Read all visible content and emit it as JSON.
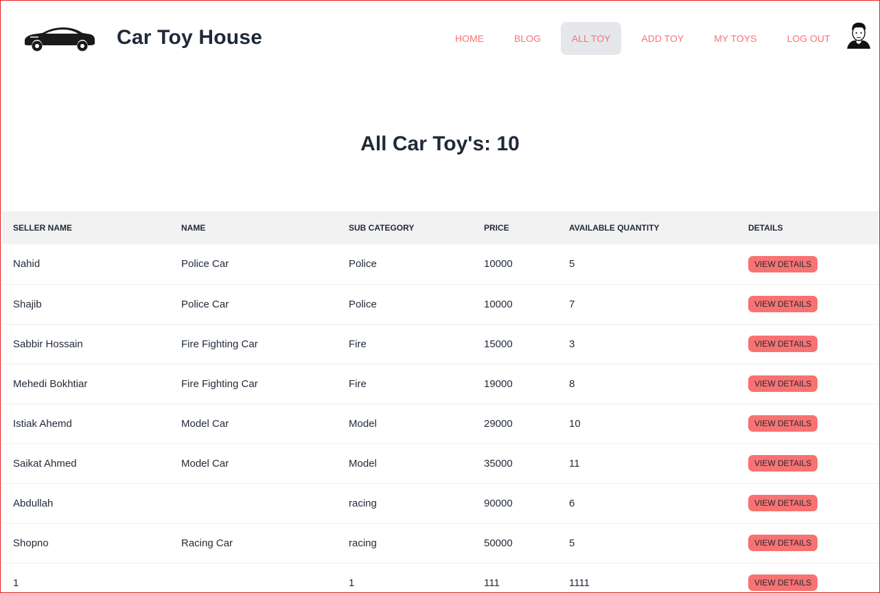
{
  "navbar": {
    "brand": "Car Toy House",
    "links": [
      {
        "label": "Home",
        "active": false
      },
      {
        "label": "Blog",
        "active": false
      },
      {
        "label": "All Toy",
        "active": true
      },
      {
        "label": "Add Toy",
        "active": false
      },
      {
        "label": "My Toys",
        "active": false
      },
      {
        "label": "Log Out",
        "active": false
      }
    ]
  },
  "page": {
    "title": "All Car Toy's: 10"
  },
  "table": {
    "headers": [
      "Seller Name",
      "Name",
      "Sub Category",
      "Price",
      "Available Quantity",
      "Details"
    ],
    "rows": [
      {
        "seller": "Nahid",
        "name": "Police Car",
        "sub_category": "Police",
        "price": "10000",
        "quantity": "5",
        "action": "View Details"
      },
      {
        "seller": "Shajib",
        "name": "Police Car",
        "sub_category": "Police",
        "price": "10000",
        "quantity": "7",
        "action": "View Details"
      },
      {
        "seller": "Sabbir Hossain",
        "name": "Fire Fighting Car",
        "sub_category": "Fire",
        "price": "15000",
        "quantity": "3",
        "action": "View Details"
      },
      {
        "seller": "Mehedi Bokhtiar",
        "name": "Fire Fighting Car",
        "sub_category": "Fire",
        "price": "19000",
        "quantity": "8",
        "action": "View Details"
      },
      {
        "seller": "Istiak Ahemd",
        "name": "Model Car",
        "sub_category": "Model",
        "price": "29000",
        "quantity": "10",
        "action": "View Details"
      },
      {
        "seller": "Saikat Ahmed",
        "name": "Model Car",
        "sub_category": "Model",
        "price": "35000",
        "quantity": "11",
        "action": "View Details"
      },
      {
        "seller": "Abdullah",
        "name": "",
        "sub_category": "racing",
        "price": "90000",
        "quantity": "6",
        "action": "View Details"
      },
      {
        "seller": "Shopno",
        "name": "Racing Car",
        "sub_category": "racing",
        "price": "50000",
        "quantity": "5",
        "action": "View Details"
      },
      {
        "seller": "1",
        "name": "",
        "sub_category": "1",
        "price": "111",
        "quantity": "1111",
        "action": "View Details"
      }
    ]
  },
  "colors": {
    "accent": "#f87272",
    "text": "#1f2937",
    "header_bg": "#f2f2f2",
    "active_nav_bg": "#e5e7eb"
  },
  "icons": {
    "logo": "car-logo-icon",
    "avatar": "user-avatar-icon"
  }
}
